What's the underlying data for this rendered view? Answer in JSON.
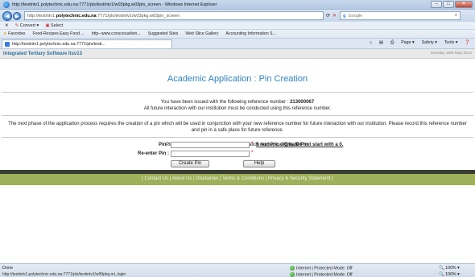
{
  "browser": {
    "window_title": "http://testintv1.polytechnic.edu.na:7771/pls/testintv1/w03pkg.w03pin_screen - Windows Internet Explorer",
    "address_prefix": "http://testintv1.",
    "address_host": "polytechnic.edu.na",
    "address_rest": ":7771/pls/testintv1/w03pkg.w03pin_screen",
    "search_engine": "Google",
    "convert_label": "Convert",
    "select_label": "Select",
    "favorites_label": "Favorites",
    "favorites_items": [
      "Food-Recipes Easy Food ...",
      "http--www.consciouslivin...",
      "Suggested Sites",
      "Web Slice Gallery",
      "Accounting Information S..."
    ],
    "tab_title": "http://testintv1.polytechnic.edu.na:7771/pls/testi...",
    "commands": [
      "Page",
      "Safety",
      "Tools"
    ]
  },
  "site": {
    "name": "Integrated Tertiary Software Itsv13",
    "date": "Monday, 28th May 2012"
  },
  "page": {
    "title": "Academic Application : Pin Creation",
    "ref_line1": "You have been issued with the following reference number :",
    "ref_number": "213000067",
    "ref_line2": "All future interaction with our institution must be conducted using this reference number.",
    "next_phase": "The next phase of the application process requires the creation of a pin which will be used in conjunction with your new reference number for future interaction with our institution. Please record this reference number and pin in a safe place for future reference.",
    "instruction": "Please Enter Your Pin and Pin Confirmation And Press",
    "instruction_action": "Create Pin",
    "pin_label": "Pin :",
    "reenter_label": "Re-enter Pin :",
    "required_mark": "*",
    "pin_hint": "5 numeric digits. Do not start with a 0.",
    "create_button": "Create Pin",
    "help_button": "Help"
  },
  "footer": {
    "links": "| Contact Us | About Us | Disclaimer | Terms & Conditions | Privacy & Security Statement |"
  },
  "status": {
    "done": "Done",
    "link_url": "http://testintv1.polytechnic.edu.na:7771/pls/testintv1/w99pkg.mi_login",
    "zone": "Internet | Protected Mode: Off",
    "zoom": "100%"
  },
  "colors": {
    "title_blue": "#2d82c1",
    "footer_band": "#9fb05a",
    "dark_band": "#3a3d32",
    "required_red": "#d40000"
  }
}
